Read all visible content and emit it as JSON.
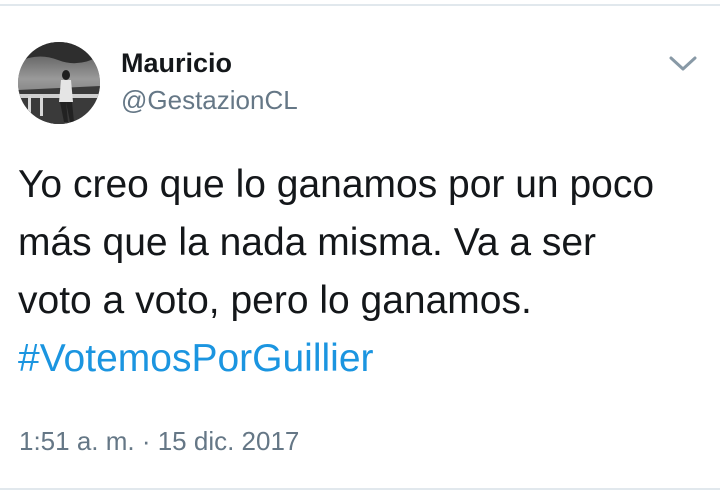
{
  "tweet": {
    "display_name": "Mauricio",
    "handle": "@GestazionCL",
    "text_lines": [
      "Yo creo que lo ganamos por un poco",
      "más que la nada misma. Va a ser",
      "voto a voto, pero lo ganamos."
    ],
    "hashtag": "#VotemosPorGuillier",
    "timestamp": "1:51 a. m. · 15 dic. 2017"
  },
  "icons": {
    "avatar": "avatar-photo",
    "menu": "chevron-down-icon"
  },
  "colors": {
    "link": "#1b95e0",
    "secondary_text": "#657786",
    "primary_text": "#14171a",
    "divider": "#e1e8ed"
  }
}
